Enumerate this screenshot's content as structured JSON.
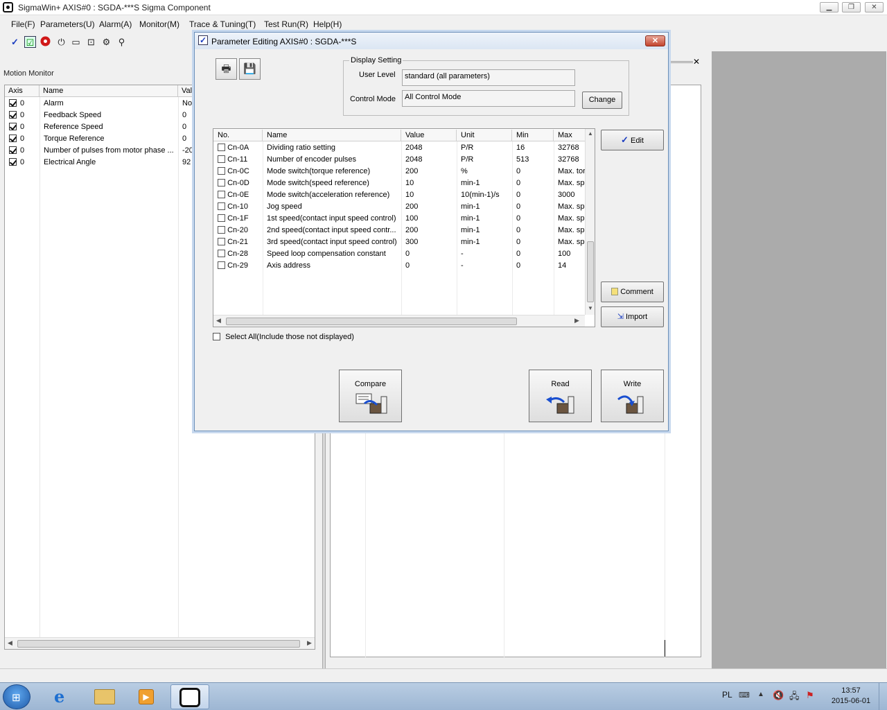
{
  "app": {
    "title": "SigmaWin+ AXIS#0 : SGDA-***S Sigma Component",
    "window_buttons": [
      "minimize",
      "restore",
      "close"
    ]
  },
  "menu": [
    "File(F)",
    "Parameters(U)",
    "Alarm(A)",
    "Monitor(M)",
    "Trace & Tuning(T)",
    "Test Run(R)",
    "Help(H)"
  ],
  "toolbar_icons": [
    "check-icon",
    "checklist-icon",
    "stop-icon",
    "alarm-icon",
    "monitor-icon",
    "trace-icon",
    "jog-icon",
    "tuning-icon"
  ],
  "motion_monitor": {
    "title": "Motion Monitor",
    "columns": [
      "Axis",
      "Name",
      "Val"
    ],
    "rows": [
      {
        "axis": "0",
        "name": "Alarm",
        "value": "Nor"
      },
      {
        "axis": "0",
        "name": "Feedback Speed",
        "value": "0"
      },
      {
        "axis": "0",
        "name": "Reference Speed",
        "value": "0"
      },
      {
        "axis": "0",
        "name": "Torque Reference",
        "value": "0"
      },
      {
        "axis": "0",
        "name": "Number of pulses from motor phase ...",
        "value": "-20"
      },
      {
        "axis": "0",
        "name": "Electrical Angle",
        "value": "92"
      }
    ]
  },
  "dialog": {
    "title": "Parameter Editing AXIS#0 : SGDA-***S",
    "close_label": "✕",
    "display_setting": {
      "legend": "Display Setting",
      "user_level_label": "User Level",
      "user_level_value": "standard (all parameters)",
      "control_mode_label": "Control Mode",
      "control_mode_value": "All Control Mode",
      "change_label": "Change"
    },
    "table": {
      "columns": [
        "No.",
        "Name",
        "Value",
        "Unit",
        "Min",
        "Max"
      ],
      "rows": [
        {
          "no": "Cn-0A",
          "name": "Dividing ratio setting",
          "value": "2048",
          "unit": "P/R",
          "min": "16",
          "max": "32768"
        },
        {
          "no": "Cn-11",
          "name": "Number of encoder pulses",
          "value": "2048",
          "unit": "P/R",
          "min": "513",
          "max": "32768"
        },
        {
          "no": "Cn-0C",
          "name": "Mode switch(torque reference)",
          "value": "200",
          "unit": "%",
          "min": "0",
          "max": "Max. tor"
        },
        {
          "no": "Cn-0D",
          "name": "Mode switch(speed reference)",
          "value": "10",
          "unit": "min-1",
          "min": "0",
          "max": "Max. sp"
        },
        {
          "no": "Cn-0E",
          "name": "Mode switch(acceleration reference)",
          "value": "10",
          "unit": "10(min-1)/s",
          "min": "0",
          "max": "3000"
        },
        {
          "no": "Cn-10",
          "name": "Jog speed",
          "value": "200",
          "unit": "min-1",
          "min": "0",
          "max": "Max. sp"
        },
        {
          "no": "Cn-1F",
          "name": "1st speed(contact input speed control)",
          "value": "100",
          "unit": "min-1",
          "min": "0",
          "max": "Max. sp"
        },
        {
          "no": "Cn-20",
          "name": "2nd speed(contact input speed contr...",
          "value": "200",
          "unit": "min-1",
          "min": "0",
          "max": "Max. sp"
        },
        {
          "no": "Cn-21",
          "name": "3rd speed(contact input speed control)",
          "value": "300",
          "unit": "min-1",
          "min": "0",
          "max": "Max. sp"
        },
        {
          "no": "Cn-28",
          "name": "Speed loop compensation constant",
          "value": "0",
          "unit": "-",
          "min": "0",
          "max": "100"
        },
        {
          "no": "Cn-29",
          "name": "Axis address",
          "value": "0",
          "unit": "-",
          "min": "0",
          "max": "14"
        }
      ]
    },
    "edit_label": "Edit",
    "comment_label": "Comment",
    "import_label": "Import",
    "select_all_label": "Select All(Include those not displayed)",
    "compare_label": "Compare",
    "read_label": "Read",
    "write_label": "Write"
  },
  "taskbar": {
    "language": "PL",
    "time": "13:57",
    "date": "2015-06-01"
  }
}
